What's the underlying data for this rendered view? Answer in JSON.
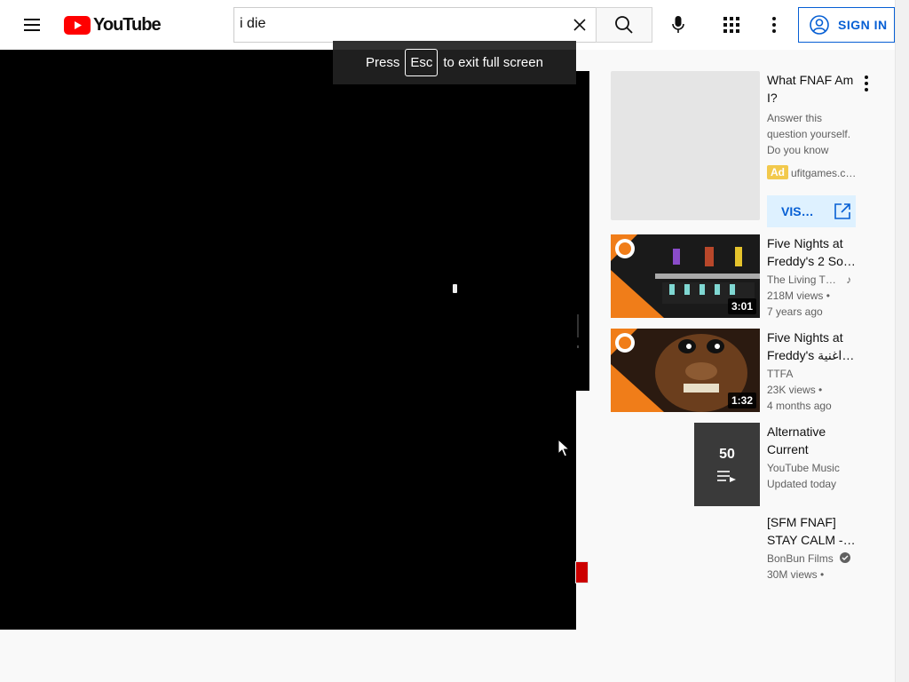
{
  "header": {
    "logo_text": "YouTube",
    "search_value": "i die",
    "signin_label": "SIGN IN"
  },
  "player": {
    "toast_press": "Press",
    "toast_key": "Esc",
    "toast_rest": "to exit full screen"
  },
  "ad": {
    "title_line1": "What FNAF Am",
    "title_line2": "I?",
    "desc_line1": "Answer this",
    "desc_line2": "question yourself.",
    "desc_line3": "Do you know Fiv…",
    "badge": "Ad",
    "domain": "ufitgames.c…",
    "visit_label": "VIS…"
  },
  "recommendations": [
    {
      "title_line1": "Five Nights at",
      "title_line2": "Freddy's 2 So…",
      "channel": "The Living T…",
      "views": "218M views •",
      "age": "7 years ago",
      "duration": "3:01"
    },
    {
      "title_line1": "Five Nights at",
      "title_line2": "Freddy's اغنية I…",
      "channel": "TTFA",
      "views": "23K views •",
      "age": "4 months ago",
      "duration": "1:32"
    },
    {
      "title_line1": "Alternative",
      "title_line2": "Current",
      "channel": "YouTube Music",
      "age": "Updated today",
      "count": "50"
    },
    {
      "title_line1": "[SFM FNAF]",
      "title_line2": "STAY CALM -…",
      "channel": "BonBun Films",
      "views": "30M views •"
    }
  ],
  "colors": {
    "brand_red": "#ff0000",
    "accent_blue": "#065fd4",
    "ad_badge": "#f2c94c",
    "thumb_orange": "#f07d19"
  }
}
